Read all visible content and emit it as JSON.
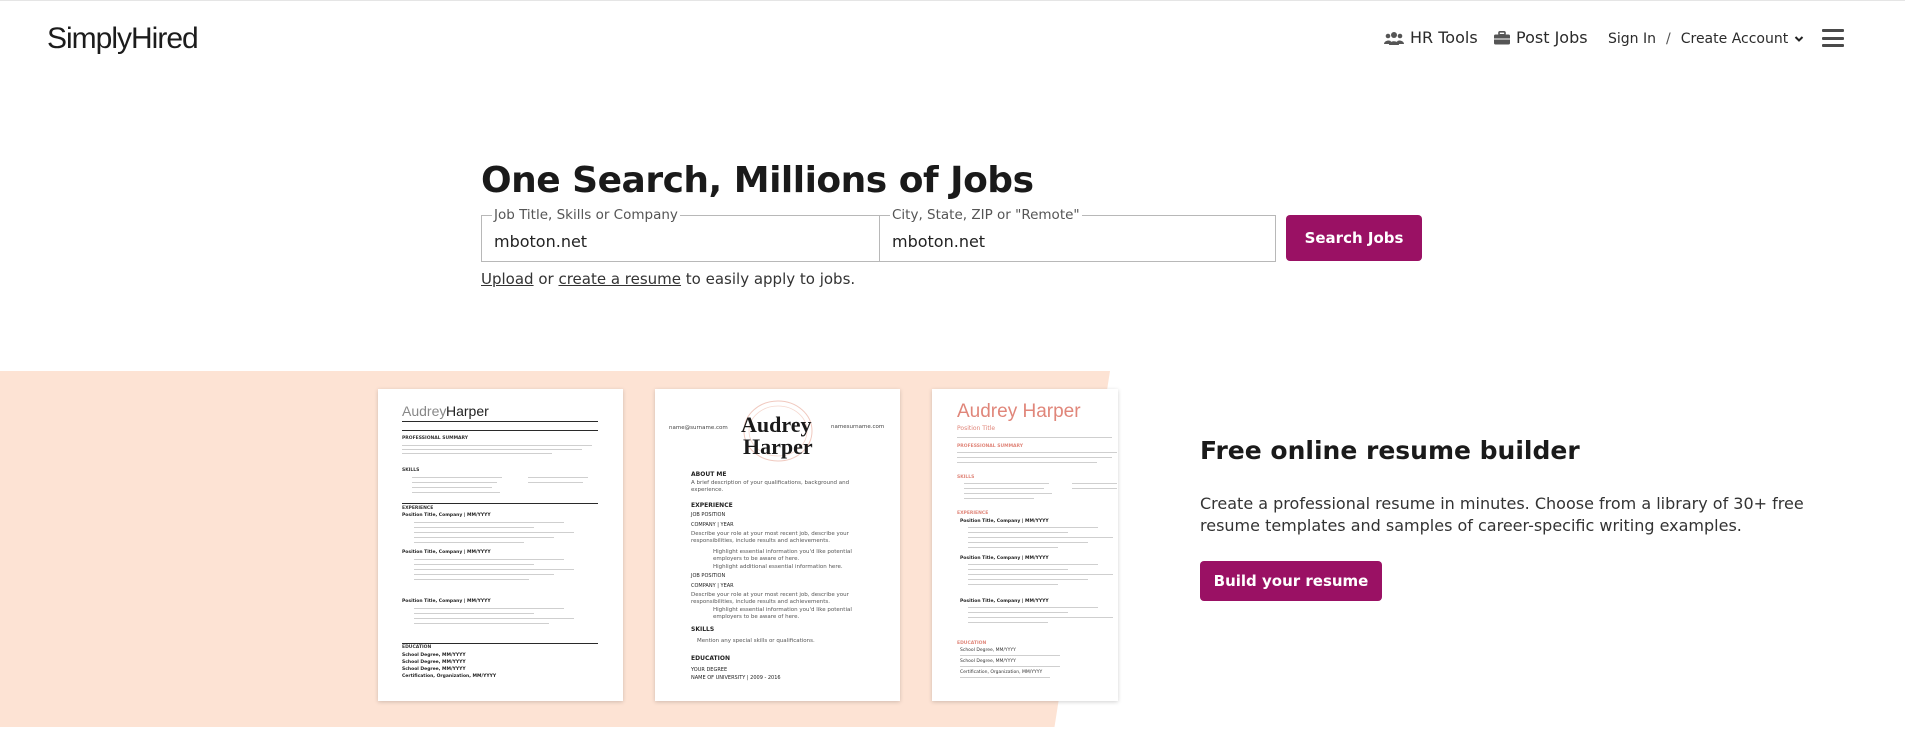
{
  "header": {
    "logo": "SimplyHired",
    "nav": {
      "hr_tools": "HR Tools",
      "post_jobs": "Post Jobs",
      "sign_in": "Sign In",
      "separator": "/",
      "create_account": "Create Account"
    },
    "icons": [
      "users-icon",
      "briefcase-icon",
      "chevron-down-icon",
      "menu-icon"
    ]
  },
  "hero": {
    "title": "One Search, Millions of Jobs",
    "what_label": "Job Title, Skills or Company",
    "what_value": "mboton.net",
    "where_label": "City, State, ZIP or \"Remote\"",
    "where_value": "mboton.net",
    "search_button": "Search Jobs",
    "sub_upload": "Upload",
    "sub_or": " or ",
    "sub_create": "create a resume",
    "sub_rest": " to easily apply to jobs."
  },
  "promo": {
    "title": "Free online resume builder",
    "description": "Create a professional resume in minutes. Choose from a library of 30+ free resume templates and samples of career-specific writing examples.",
    "button": "Build your resume",
    "resume1": {
      "first_name": "Audrey",
      "last_name": "Harper",
      "section_summary": "PROFESSIONAL SUMMARY",
      "section_skills": "SKILLS",
      "section_experience": "EXPERIENCE",
      "job1": "Position Title, Company | MM/YYYY",
      "job2": "Position Title, Company | MM/YYYY",
      "job3": "Position Title, Company | MM/YYYY",
      "section_education": "EDUCATION",
      "edu1": "School Degree, MM/YYYY",
      "edu2": "School Degree, MM/YYYY",
      "edu3": "School Degree, MM/YYYY",
      "edu4": "Certification, Organization, MM/YYYY"
    },
    "resume2": {
      "email": "name@surname.com",
      "website": "namesurname.com",
      "first_name": "Audrey",
      "last_name": "Harper",
      "section_about": "ABOUT ME",
      "about_text": "A brief description of your qualifications, background and experience.",
      "section_experience": "EXPERIENCE",
      "job_position": "JOB POSITION",
      "company_year": "COMPANY | YEAR",
      "job_text": "Describe your role at your most recent job, describe your responsibilities, include results and achievements.",
      "bullet1": "Highlight essential information you'd like potential employers to be aware of here.",
      "bullet2": "Highlight additional essential information here.",
      "job_position2": "JOB POSITION",
      "company_year2": "COMPANY | YEAR",
      "job_text2": "Describe your role at your most recent job, describe your responsibilities, include results and achievements.",
      "bullet3": "Highlight essential information you'd like potential employers to be aware of here.",
      "section_skills": "SKILLS",
      "skills_text": "Mention any special skills or qualifications.",
      "section_education": "EDUCATION",
      "degree": "YOUR DEGREE",
      "university": "NAME OF UNIVERSITY | 2009 - 2016"
    },
    "resume3": {
      "name": "Audrey Harper",
      "position": "Position Title",
      "section_summary": "PROFESSIONAL SUMMARY",
      "section_skills": "SKILLS",
      "section_experience": "EXPERIENCE",
      "job1": "Position Title, Company | MM/YYYY",
      "job2": "Position Title, Company | MM/YYYY",
      "job3": "Position Title, Company | MM/YYYY",
      "section_education": "EDUCATION",
      "edu1": "School Degree, MM/YYYY",
      "edu2": "School Degree, MM/YYYY",
      "edu3": "Certification, Organization, MM/YYYY"
    }
  },
  "colors": {
    "brand": "#9a1164",
    "promo_background": "#fde3d4",
    "resume3_accent": "#e0867a"
  }
}
